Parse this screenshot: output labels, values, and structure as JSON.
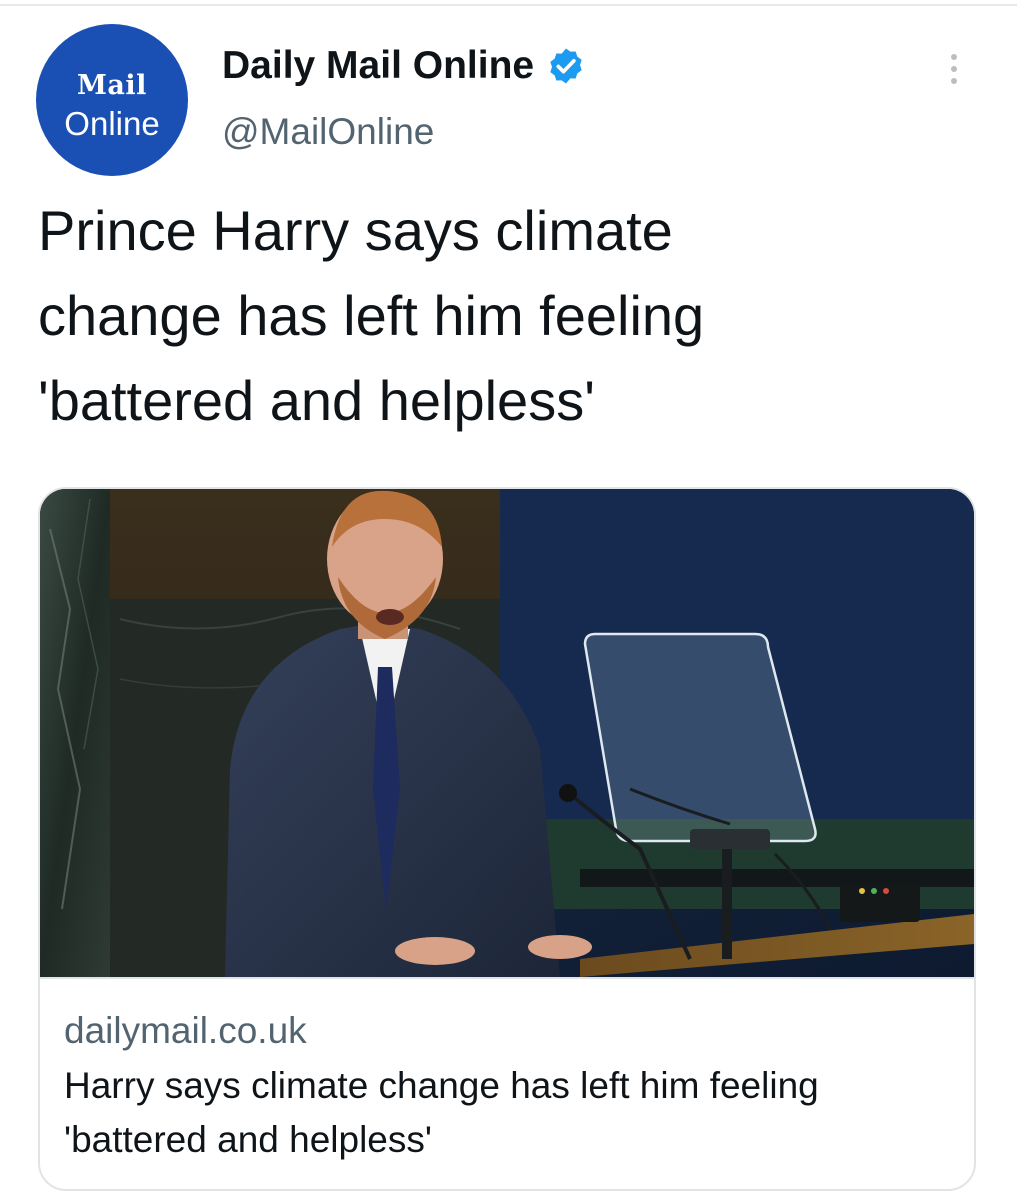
{
  "tweet": {
    "author": {
      "display_name": "Daily Mail Online",
      "handle": "@MailOnline",
      "verified": true,
      "avatar": {
        "line1": "Mail",
        "line2": "Online",
        "background_color": "#1a4fb4"
      }
    },
    "more_icon": "more-horizontal-icon",
    "text": "Prince Harry says climate\nchange has left him feeling\n'battered and helpless'",
    "card": {
      "image_icon": "photo-speaker-at-podium",
      "domain": "dailymail.co.uk",
      "title": "Harry says climate change has left him feeling 'battered and helpless'"
    }
  },
  "colors": {
    "text_primary": "#0f1419",
    "text_secondary": "#536471",
    "verified_blue": "#1d9bf0",
    "border": "#e1e4e7"
  }
}
